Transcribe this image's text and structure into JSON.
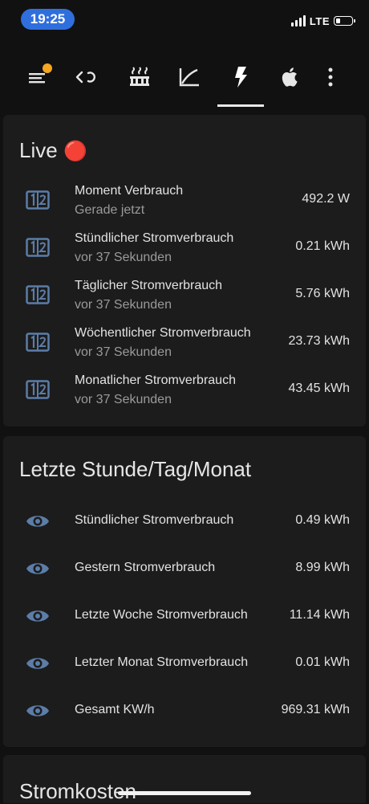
{
  "status_bar": {
    "time": "19:25",
    "network": "LTE"
  },
  "toolbar": {
    "tabs": [
      {
        "icon": "menu-icon",
        "active": false
      },
      {
        "icon": "code-icon",
        "active": false
      },
      {
        "icon": "radiator-icon",
        "active": false
      },
      {
        "icon": "chart-line-icon",
        "active": false
      },
      {
        "icon": "flash-icon",
        "active": true
      },
      {
        "icon": "apple-icon",
        "active": false
      },
      {
        "icon": "more-vertical-icon",
        "active": false
      }
    ]
  },
  "live_card": {
    "title": "Live",
    "title_emoji": "🔴",
    "rows": [
      {
        "label": "Moment Verbrauch",
        "sub": "Gerade jetzt",
        "value": "492.2 W"
      },
      {
        "label": "Stündlicher Stromverbrauch",
        "sub": "vor 37 Sekunden",
        "value": "0.21 kWh"
      },
      {
        "label": "Täglicher Stromverbrauch",
        "sub": "vor 37 Sekunden",
        "value": "5.76 kWh"
      },
      {
        "label": "Wöchentlicher Stromverbrauch",
        "sub": "vor 37 Sekunden",
        "value": "23.73 kWh"
      },
      {
        "label": "Monatlicher Stromverbrauch",
        "sub": "vor 37 Sekunden",
        "value": "43.45 kWh"
      }
    ]
  },
  "history_card": {
    "title": "Letzte Stunde/Tag/Monat",
    "rows": [
      {
        "label": "Stündlicher Stromverbrauch",
        "value": "0.49 kWh"
      },
      {
        "label": "Gestern Stromverbrauch",
        "value": "8.99 kWh"
      },
      {
        "label": "Letzte Woche Stromverbrauch",
        "value": "11.14 kWh"
      },
      {
        "label": "Letzter Monat Stromverbrauch",
        "value": "0.01 kWh"
      },
      {
        "label": "Gesamt KW/h",
        "value": "969.31 kWh"
      }
    ]
  },
  "cost_card": {
    "title": "Stromkosten"
  },
  "colors": {
    "accent": "#2f6fdd",
    "icon": "#5b7da8",
    "badge": "#f5a623",
    "card": "#1c1c1c",
    "background": "#111111"
  }
}
